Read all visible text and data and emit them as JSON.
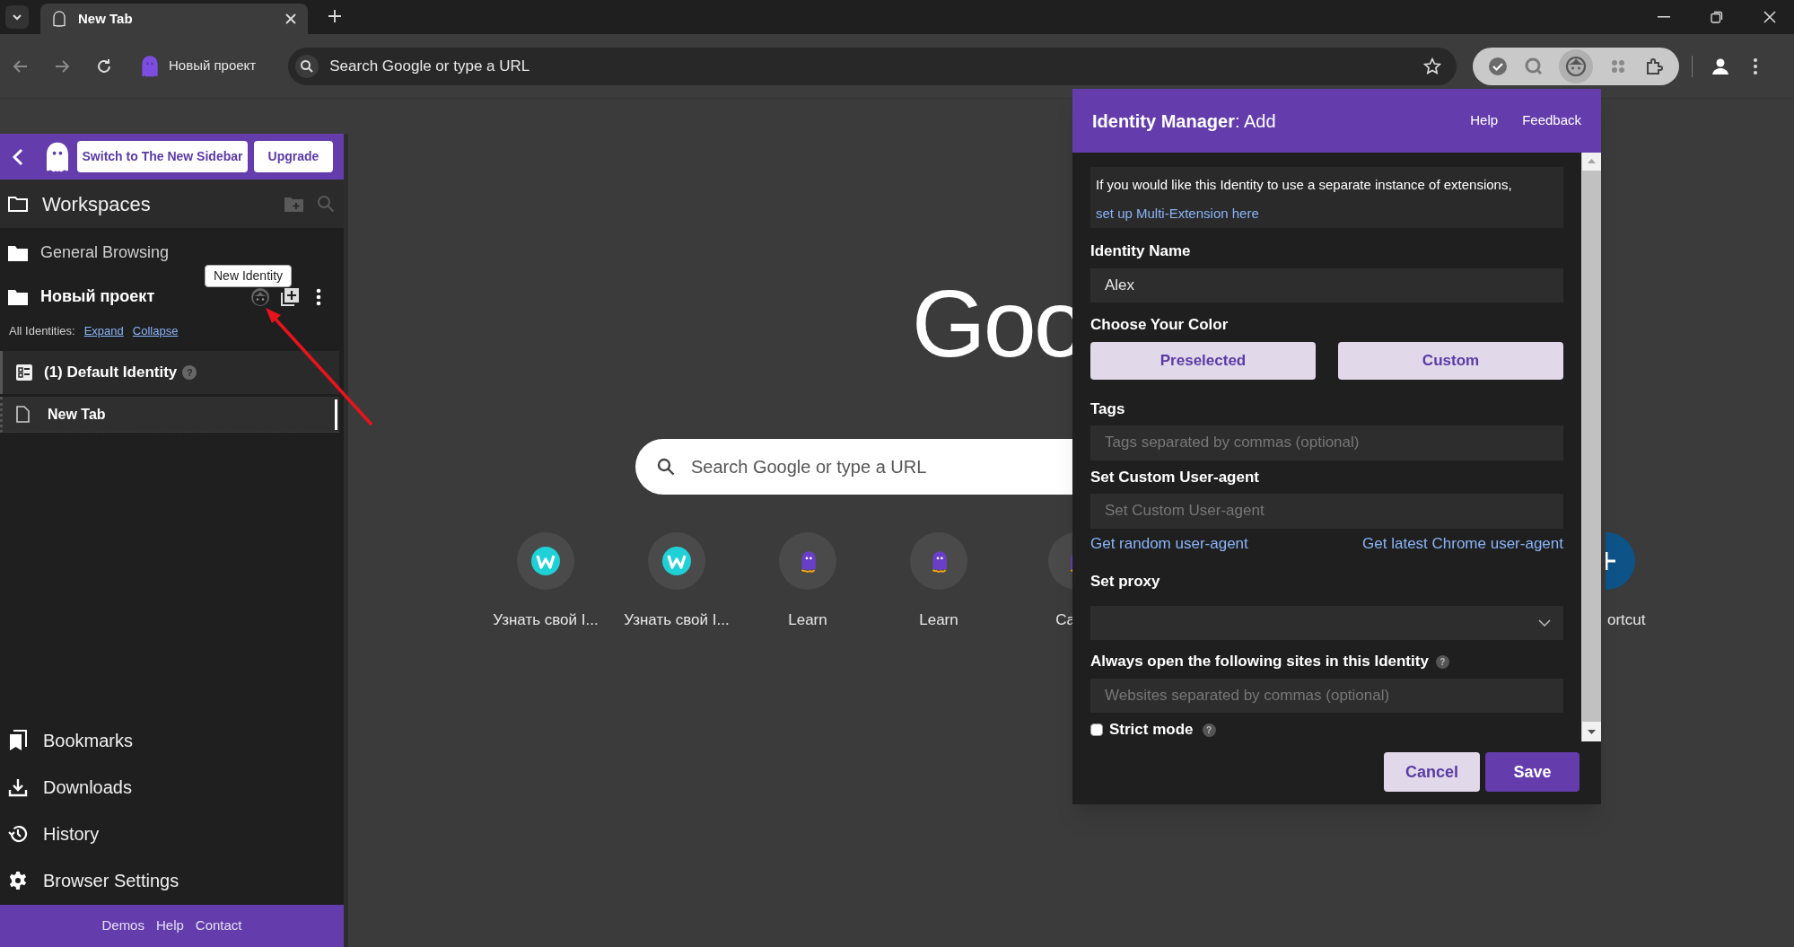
{
  "browser": {
    "tabs": [
      {
        "title": "New Tab",
        "selected": true
      }
    ],
    "profile_chip": "Новый проект",
    "omnibox": {
      "placeholder": "Search Google or type a URL"
    }
  },
  "sidebar": {
    "header_buttons": [
      "Switch to The New Sidebar",
      "Upgrade"
    ],
    "title": "Workspaces",
    "workspaces": [
      {
        "name": "General Browsing",
        "selected": false
      },
      {
        "name": "Новый проект",
        "selected": true
      }
    ],
    "tooltip": "New Identity",
    "identities_label": "All Identities:",
    "identities_links": [
      "Expand",
      "Collapse"
    ],
    "identities": [
      {
        "name": "(1) Default Identity",
        "help": "?",
        "tabs": [
          {
            "title": "New Tab",
            "selected": true
          }
        ]
      }
    ],
    "nav": [
      {
        "label": "Bookmarks",
        "kind": "bookmarks"
      },
      {
        "label": "Downloads",
        "kind": "downloads"
      },
      {
        "label": "History",
        "kind": "history"
      },
      {
        "label": "Browser Settings",
        "kind": "settings"
      }
    ],
    "footer_links": [
      "Demos",
      "Help",
      "Contact"
    ]
  },
  "new_tab_page": {
    "logo": "Goo",
    "search_placeholder": "Search Google or type a URL",
    "shortcuts": [
      {
        "label": "Узнать свой I...",
        "kind": "w"
      },
      {
        "label": "Узнать свой I...",
        "kind": "w"
      },
      {
        "label": "Learn",
        "kind": "ghost"
      },
      {
        "label": "Learn",
        "kind": "ghost"
      }
    ],
    "cut_shortcut_left": {
      "label": "Ca",
      "kind": "ghost"
    },
    "cut_shortcut_right": {
      "label": "ortcut",
      "kind": "add"
    }
  },
  "popup": {
    "title": "**Identity Manager**: Add",
    "header_links": [
      "Help",
      "Feedback"
    ],
    "notice": {
      "text": "If you would like this Identity to use a separate instance of extensions, ",
      "link": "set up Multi-Extension here"
    },
    "sections": [
      {
        "kind": "text",
        "label": "Identity Name",
        "value": "Alex"
      },
      {
        "kind": "color",
        "label": "Choose Your Color",
        "options": [
          "Preselected",
          "Custom"
        ]
      },
      {
        "kind": "text",
        "label": "Tags",
        "placeholder": "Tags separated by commas (optional)"
      },
      {
        "kind": "text",
        "label": "Set Custom User-agent",
        "placeholder": "Set Custom User-agent",
        "links": [
          "Get random user-agent",
          "Get latest Chrome user-agent"
        ]
      },
      {
        "kind": "select",
        "label": "Set proxy"
      },
      {
        "kind": "text",
        "label": "Always open the following sites in this Identity",
        "help": "?",
        "placeholder": "Websites separated by commas (optional)"
      },
      {
        "kind": "checkbox",
        "label": "Strict mode",
        "help": "?",
        "checked": false
      }
    ],
    "buttons": [
      {
        "label": "Cancel",
        "kind": "secondary"
      },
      {
        "label": "Save",
        "kind": "primary"
      }
    ]
  }
}
